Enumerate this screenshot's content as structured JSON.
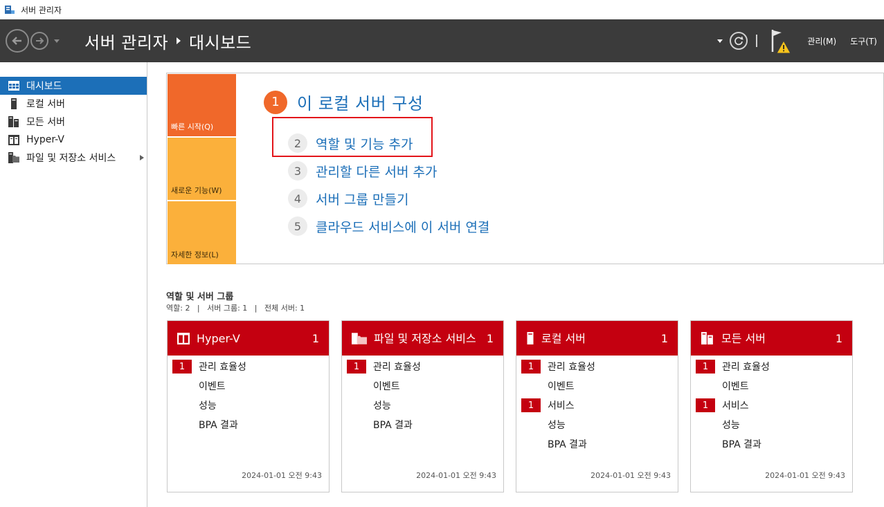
{
  "window": {
    "title": "서버 관리자"
  },
  "header": {
    "crumb_root": "서버 관리자",
    "crumb_current": "대시보드",
    "menu_manage": "관리(M)",
    "menu_tools": "도구(T)"
  },
  "sidebar": {
    "items": [
      {
        "label": "대시보드",
        "icon": "dashboard-icon"
      },
      {
        "label": "로컬 서버",
        "icon": "local-server-icon"
      },
      {
        "label": "모든 서버",
        "icon": "all-servers-icon"
      },
      {
        "label": "Hyper-V",
        "icon": "hyperv-icon"
      },
      {
        "label": "파일 및 저장소 서비스",
        "icon": "file-storage-icon"
      }
    ]
  },
  "quick_start": {
    "tiles": [
      "빠른 시작(Q)",
      "새로운 기능(W)",
      "자세한 정보(L)"
    ],
    "step1": {
      "num": "1",
      "label": "이 로컬 서버 구성"
    },
    "steps": [
      {
        "num": "2",
        "label": "역할 및 기능 추가"
      },
      {
        "num": "3",
        "label": "관리할 다른 서버 추가"
      },
      {
        "num": "4",
        "label": "서버 그룹 만들기"
      },
      {
        "num": "5",
        "label": "클라우드 서비스에 이 서버 연결"
      }
    ]
  },
  "roles": {
    "title": "역할 및 서버 그룹",
    "subtitle": "역할: 2   |   서버 그룹: 1   |   전체 서버: 1",
    "cards": [
      {
        "title": "Hyper-V",
        "count": "1",
        "rows": [
          {
            "badge": "1",
            "label": "관리 효율성"
          },
          {
            "badge": "",
            "label": "이벤트"
          },
          {
            "badge": "",
            "label": "성능"
          },
          {
            "badge": "",
            "label": "BPA 결과"
          }
        ],
        "timestamp": "2024-01-01 오전 9:43"
      },
      {
        "title": "파일 및 저장소 서비스",
        "count": "1",
        "rows": [
          {
            "badge": "1",
            "label": "관리 효율성"
          },
          {
            "badge": "",
            "label": "이벤트"
          },
          {
            "badge": "",
            "label": "성능"
          },
          {
            "badge": "",
            "label": "BPA 결과"
          }
        ],
        "timestamp": "2024-01-01 오전 9:43"
      },
      {
        "title": "로컬 서버",
        "count": "1",
        "rows": [
          {
            "badge": "1",
            "label": "관리 효율성"
          },
          {
            "badge": "",
            "label": "이벤트"
          },
          {
            "badge": "1",
            "label": "서비스"
          },
          {
            "badge": "",
            "label": "성능"
          },
          {
            "badge": "",
            "label": "BPA 결과"
          }
        ],
        "timestamp": "2024-01-01 오전 9:43"
      },
      {
        "title": "모든 서버",
        "count": "1",
        "rows": [
          {
            "badge": "1",
            "label": "관리 효율성"
          },
          {
            "badge": "",
            "label": "이벤트"
          },
          {
            "badge": "1",
            "label": "서비스"
          },
          {
            "badge": "",
            "label": "성능"
          },
          {
            "badge": "",
            "label": "BPA 결과"
          }
        ],
        "timestamp": "2024-01-01 오전 9:43"
      }
    ]
  },
  "colors": {
    "accent": "#1c6fb8",
    "header_bg": "#3b3b3b",
    "orange": "#f0682a",
    "amber": "#fbb03b",
    "card_red": "#c40010"
  }
}
